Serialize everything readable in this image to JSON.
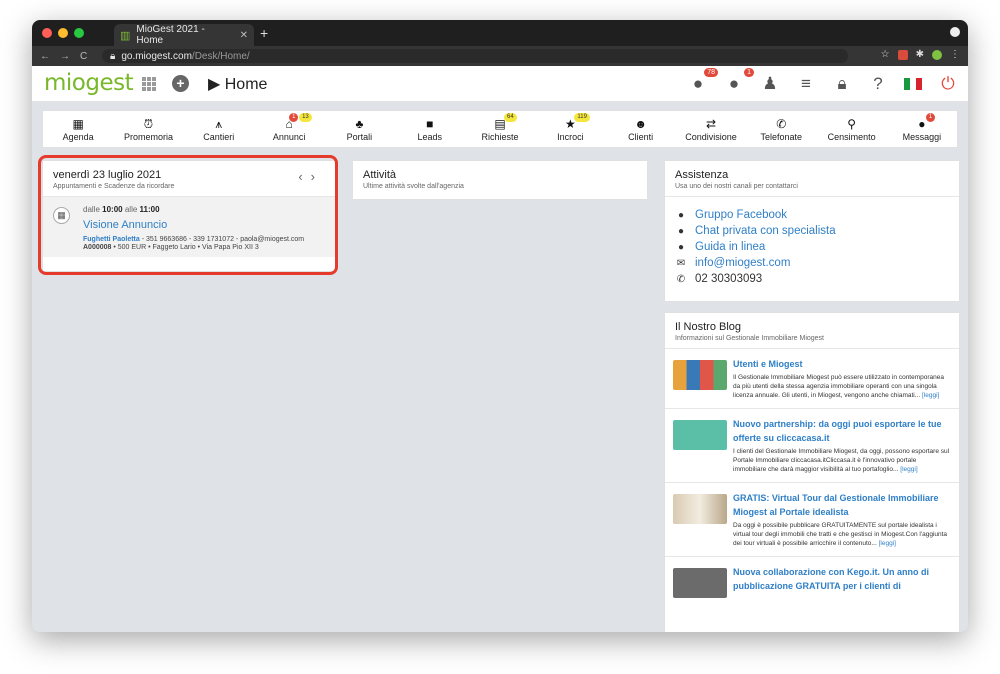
{
  "browser": {
    "tab_title": "MioGest 2021 - Home",
    "url_host": "go.miogest.com",
    "url_path": "/Desk/Home/"
  },
  "header": {
    "logo": "miogest",
    "title": "Home",
    "badges": {
      "bulb": "78",
      "chat": "1"
    }
  },
  "nav": [
    {
      "label": "Agenda",
      "icon": "calendar-icon"
    },
    {
      "label": "Promemoria",
      "icon": "alarm-clock-icon"
    },
    {
      "label": "Cantieri",
      "icon": "crane-icon"
    },
    {
      "label": "Annunci",
      "icon": "house-icon",
      "badge_red": "1",
      "badge_yellow": "13"
    },
    {
      "label": "Portali",
      "icon": "sitemap-icon"
    },
    {
      "label": "Leads",
      "icon": "message-icon"
    },
    {
      "label": "Richieste",
      "icon": "list-icon",
      "badge_yellow": "64"
    },
    {
      "label": "Incroci",
      "icon": "star-icon",
      "badge_yellow": "119"
    },
    {
      "label": "Clienti",
      "icon": "users-icon"
    },
    {
      "label": "Condivisione",
      "icon": "share-icon"
    },
    {
      "label": "Telefonate",
      "icon": "phone-icon"
    },
    {
      "label": "Censimento",
      "icon": "map-pin-icon"
    },
    {
      "label": "Messaggi",
      "icon": "chat-icon",
      "badge_red": "1"
    }
  ],
  "agenda": {
    "title": "venerdì 23 luglio 2021",
    "subtitle": "Appuntamenti e Scadenze da ricordare",
    "appointment": {
      "time_from_label": "dalle",
      "time_from": "10:00",
      "time_to_label": "alle",
      "time_to": "11:00",
      "title": "Visione Annuncio",
      "client_name": "Fughetti Paoletta",
      "client_contacts": " - 351 9663686 - 339 1731072 - paola@miogest.com",
      "listing_code": "A000008",
      "listing_details": " • 500 EUR • Faggeto Lario • Via Papa Pio XII 3"
    }
  },
  "activity": {
    "title": "Attività",
    "subtitle": "Ultime attività svolte dall'agenzia"
  },
  "support": {
    "title": "Assistenza",
    "subtitle": "Usa uno dei nostri canali per contattarci",
    "items": [
      {
        "label": "Gruppo Facebook",
        "icon": "facebook-icon"
      },
      {
        "label": "Chat privata con specialista",
        "icon": "chat-bubbles-icon"
      },
      {
        "label": "Guida in linea",
        "icon": "help-icon"
      },
      {
        "label": "info@miogest.com",
        "icon": "envelope-icon"
      },
      {
        "label": "02 30303093",
        "icon": "phone-icon"
      }
    ]
  },
  "blog": {
    "title": "Il Nostro Blog",
    "subtitle": "Informazioni sul Gestionale Immobiliare Miogest",
    "read_more": "[leggi]",
    "posts": [
      {
        "title": "Utenti e Miogest",
        "excerpt": "Il Gestionale Immobiliare Miogest può essere utilizzato in contemporanea da più utenti della stessa agenzia immobiliare operanti con una singola licenza annuale. Gli utenti, in Miogest, vengono anche chiamati..."
      },
      {
        "title": "Nuovo partnership: da oggi puoi esportare le tue offerte su cliccacasa.it",
        "excerpt": "I clienti del Gestionale Immobiliare Miogest, da oggi, possono esportare sul Portale Immobiliare cliccacasa.itCliccasa.it è l'innovativo portale immobiliare che darà maggior visibilità al tuo portafoglio..."
      },
      {
        "title": "GRATIS: Virtual Tour dal Gestionale Immobiliare Miogest al Portale idealista",
        "excerpt": "Da oggi è possibile pubblicare GRATUITAMENTE sul portale idealista i virtual tour degli immobili che tratti e che gestisci in Miogest.Con l'aggiunta dei tour virtuali è possibile arricchire il contenuto..."
      },
      {
        "title": "Nuova collaborazione con Kego.it. Un anno di pubblicazione GRATUITA per i clienti di",
        "excerpt": ""
      }
    ]
  },
  "colors": {
    "brand_green": "#78b82a",
    "link_blue": "#2f7fc6",
    "highlight_red": "#e53b2c"
  }
}
